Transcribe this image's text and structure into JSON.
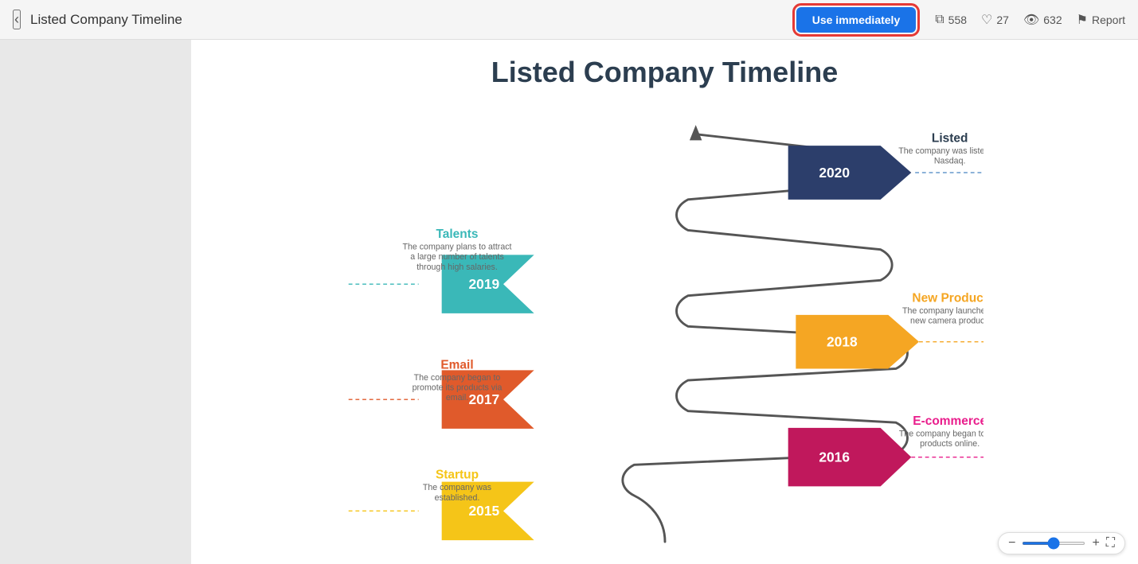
{
  "header": {
    "back_label": "‹",
    "title": "Listed Company Timeline",
    "use_immediately": "Use immediately",
    "stats": {
      "copies": "558",
      "likes": "27",
      "views": "632",
      "report": "Report"
    }
  },
  "diagram": {
    "title": "Listed Company Timeline",
    "events": [
      {
        "year": "2020",
        "color": "#2c3e6b",
        "side": "right",
        "label": "Listed",
        "description": "The company was listed on Nasdaq.",
        "icon": "🏀"
      },
      {
        "year": "2019",
        "color": "#3ab8b8",
        "side": "left",
        "label": "Talents",
        "description": "The company plans to attract a large number of talents through high salaries.",
        "icon": "⏰"
      },
      {
        "year": "2018",
        "color": "#f5a623",
        "side": "right",
        "label": "New Product",
        "description": "The company launched a new camera product.",
        "icon": "📊"
      },
      {
        "year": "2017",
        "color": "#e05a2b",
        "side": "left",
        "label": "Email",
        "description": "The company began to promote its products via email.",
        "icon": "@"
      },
      {
        "year": "2016",
        "color": "#c0185c",
        "side": "right",
        "label": "E-commerce",
        "description": "The company began to sell products online.",
        "icon": "🚴"
      },
      {
        "year": "2015",
        "color": "#f5c518",
        "side": "left",
        "label": "Startup",
        "description": "The company was established.",
        "icon": "🛍️"
      }
    ]
  },
  "toolbar": {
    "zoom_minus": "−",
    "zoom_plus": "+",
    "fullscreen": "⛶"
  }
}
